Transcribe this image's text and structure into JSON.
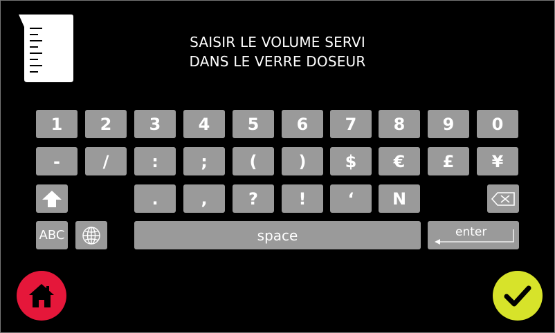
{
  "title": {
    "line1": "SAISIR LE VOLUME SERVI",
    "line2": "DANS LE VERRE DOSEUR"
  },
  "keyboard": {
    "row1": [
      "1",
      "2",
      "3",
      "4",
      "5",
      "6",
      "7",
      "8",
      "9",
      "0"
    ],
    "row2": [
      "-",
      "/",
      ":",
      ";",
      "(",
      ")",
      "$",
      "€",
      "£",
      "¥"
    ],
    "row3": [
      ".",
      ",",
      "?",
      "!",
      "‘",
      "N"
    ],
    "abc_label": "ABC",
    "space_label": "space",
    "enter_label": "enter"
  },
  "icons": {
    "beaker": "measuring-cup-icon",
    "shift": "arrow-up-icon",
    "backspace": "backspace-icon",
    "globe": "globe-icon",
    "home": "home-icon",
    "confirm": "checkmark-icon"
  },
  "colors": {
    "background": "#000000",
    "key": "#9a9a9a",
    "home_button": "#e5173a",
    "confirm_button": "#d7e32a"
  }
}
